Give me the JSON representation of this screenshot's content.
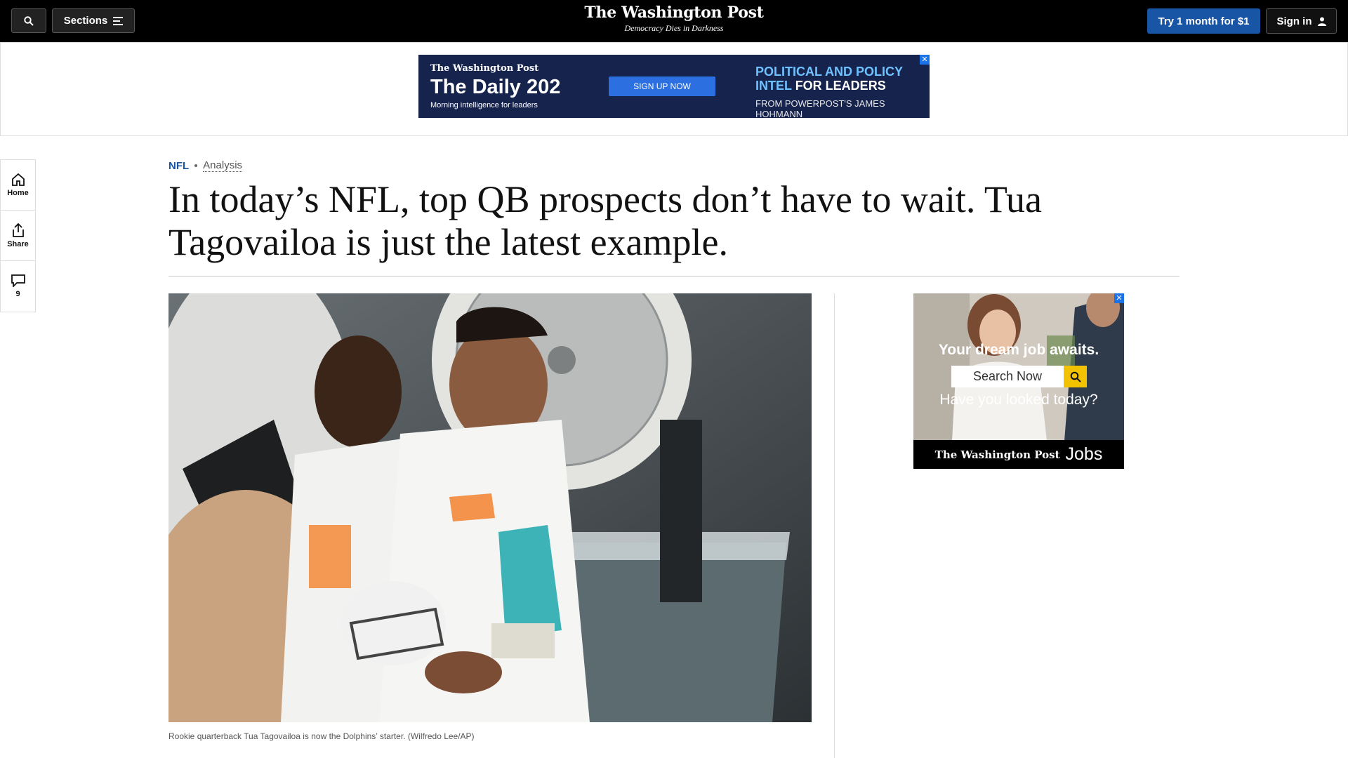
{
  "header": {
    "sections_label": "Sections",
    "logo": "The Washington Post",
    "tagline": "Democracy Dies in Darkness",
    "subscribe_label": "Try 1 month for $1",
    "signin_label": "Sign in"
  },
  "top_ad": {
    "logo": "The Washington Post",
    "title": "The Daily 202",
    "subtitle": "Morning intelligence for leaders",
    "cta": "SIGN UP NOW",
    "tagline_line1": "POLITICAL AND POLICY",
    "tagline_line2a": "INTEL",
    "tagline_line2b": "FOR LEADERS",
    "byline": "FROM POWERPOST'S JAMES HOHMANN",
    "close_label": "✕"
  },
  "rail": {
    "home_label": "Home",
    "share_label": "Share",
    "comments_count": "9"
  },
  "article": {
    "section": "NFL",
    "label": "Analysis",
    "headline": "In today’s NFL, top QB prospects don’t have to wait. Tua Tagovailoa is just the latest example.",
    "caption": "Rookie quarterback Tua Tagovailoa is now the Dolphins’ starter. (Wilfredo Lee/AP)"
  },
  "side_ad": {
    "headline": "Your dream job awaits.",
    "search_label": "Search Now",
    "question": "Have you looked today?",
    "logo": "The Washington Post",
    "jobs": "Jobs",
    "close_label": "✕"
  }
}
